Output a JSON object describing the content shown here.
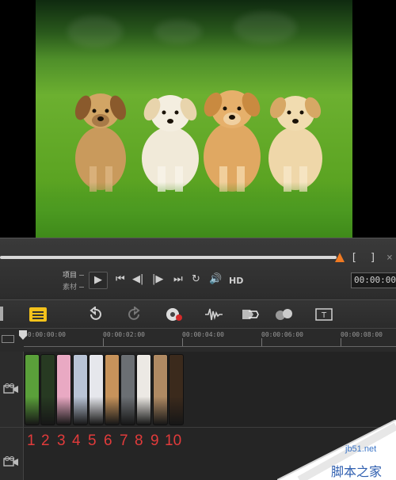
{
  "player": {
    "mode_project": "项目",
    "mode_clip": "素材",
    "hd_label": "HD",
    "bracket_in": "[",
    "bracket_out": "]",
    "timecode": "00:00:00",
    "progress": 0.85
  },
  "icons": {
    "play": "play-icon",
    "prev": "skip-start-icon",
    "step_back": "step-back-icon",
    "step_fwd": "step-forward-icon",
    "next": "skip-end-icon",
    "repeat": "repeat-icon",
    "volume": "volume-icon"
  },
  "toolbar": {
    "items": [
      "storyboard-view",
      "undo",
      "redo",
      "record-capture",
      "audio-mixer",
      "motion-tracking",
      "auto-music",
      "title"
    ]
  },
  "ruler": {
    "labels": [
      "00:00:00:00",
      "00:00:02:00",
      "00:00:04:00",
      "00:00:06:00",
      "00:00:08:00"
    ]
  },
  "clip_numbers": [
    "1",
    "2",
    "3",
    "4",
    "5",
    "6",
    "7",
    "8",
    "9",
    "10"
  ],
  "clip_colors": [
    "#5aa03a",
    "#273a22",
    "#e9a9c3",
    "#b9c4d6",
    "#e6e7ec",
    "#c7935b",
    "#6b6f73",
    "#ece9e4",
    "#b08a63",
    "#3b2a1c"
  ],
  "watermark": {
    "site": "jb51.net",
    "title": "脚本之家"
  },
  "colors": {
    "accent": "#f07a22",
    "numbers": "#e23b3b",
    "storyboard": "#f4c21b"
  }
}
